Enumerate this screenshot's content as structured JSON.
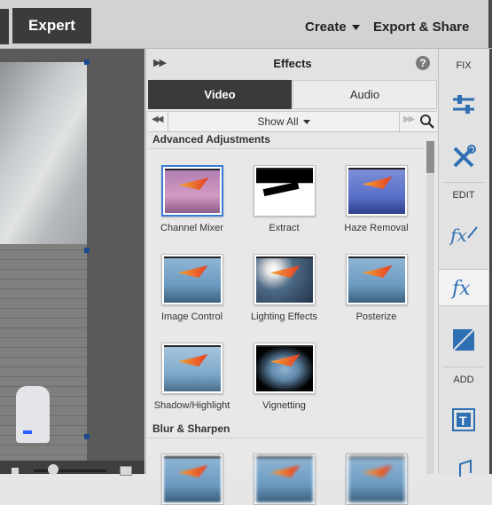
{
  "header": {
    "mode_tab": "Expert",
    "create_label": "Create",
    "export_label": "Export & Share"
  },
  "panel": {
    "title": "Effects",
    "help": "?",
    "tabs": [
      {
        "label": "Video",
        "active": true
      },
      {
        "label": "Audio",
        "active": false
      }
    ],
    "filter": "Show All",
    "sections": [
      {
        "title": "Advanced Adjustments",
        "effects": [
          {
            "label": "Channel Mixer",
            "selected": true
          },
          {
            "label": "Extract"
          },
          {
            "label": "Haze Removal"
          },
          {
            "label": "Image Control"
          },
          {
            "label": "Lighting Effects"
          },
          {
            "label": "Posterize"
          },
          {
            "label": "Shadow/Highlight"
          },
          {
            "label": "Vignetting"
          }
        ]
      },
      {
        "title": "Blur & Sharpen",
        "effects": []
      }
    ]
  },
  "toolbar": {
    "fix_label": "FIX",
    "edit_label": "EDIT",
    "add_label": "ADD"
  },
  "colors": {
    "accent": "#3a7bd5",
    "dark_tab": "#3a3a3a",
    "glider_orange": "#e33b26"
  }
}
